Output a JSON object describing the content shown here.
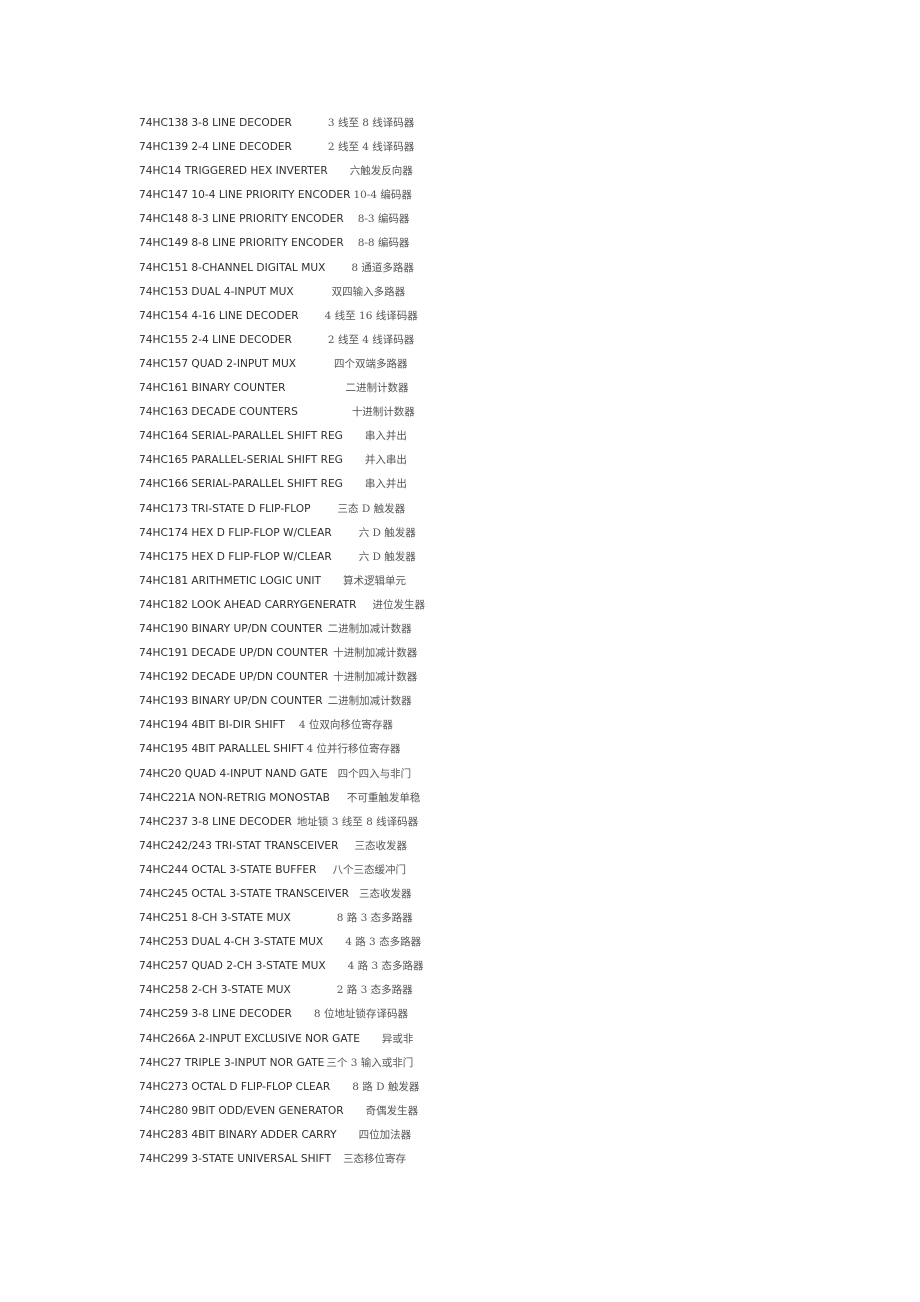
{
  "document": {
    "rows": [
      {
        "part": "74HC138 3-8 LINE DECODER",
        "gap": 36,
        "desc": "3 线至 8 线译码器"
      },
      {
        "part": "74HC139 2-4 LINE DECODER",
        "gap": 36,
        "desc": "2 线至 4 线译码器"
      },
      {
        "part": "74HC14 TRIGGERED HEX INVERTER",
        "gap": 22,
        "desc": "六触发反向器"
      },
      {
        "part": "74HC147 10-4 LINE PRIORITY ENCODER",
        "gap": 3,
        "desc": "10-4 编码器"
      },
      {
        "part": "74HC148 8-3 LINE PRIORITY ENCODER",
        "gap": 14,
        "desc": "8-3 编码器"
      },
      {
        "part": "74HC149 8-8 LINE PRIORITY ENCODER",
        "gap": 14,
        "desc": "8-8 编码器"
      },
      {
        "part": "74HC151 8-CHANNEL DIGITAL MUX",
        "gap": 26,
        "desc": "8 通道多路器"
      },
      {
        "part": "74HC153 DUAL 4-INPUT MUX",
        "gap": 38,
        "desc": "双四输入多路器"
      },
      {
        "part": "74HC154 4-16 LINE DECODER",
        "gap": 26,
        "desc": "4 线至 16 线译码器"
      },
      {
        "part": "74HC155 2-4 LINE DECODER",
        "gap": 36,
        "desc": "2 线至 4 线译码器"
      },
      {
        "part": "74HC157 QUAD 2-INPUT MUX",
        "gap": 38,
        "desc": "四个双端多路器"
      },
      {
        "part": "74HC161 BINARY COUNTER",
        "gap": 60,
        "desc": "二进制计数器"
      },
      {
        "part": "74HC163 DECADE COUNTERS",
        "gap": 54,
        "desc": "十进制计数器"
      },
      {
        "part": "74HC164 SERIAL-PARALLEL SHIFT REG",
        "gap": 22,
        "desc": "串入并出"
      },
      {
        "part": "74HC165 PARALLEL-SERIAL SHIFT REG",
        "gap": 22,
        "desc": "并入串出"
      },
      {
        "part": "74HC166 SERIAL-PARALLEL SHIFT REG",
        "gap": 22,
        "desc": "串入并出"
      },
      {
        "part": "74HC173 TRI-STATE D FLIP-FLOP",
        "gap": 27,
        "desc": "三态 D 触发器"
      },
      {
        "part": "74HC174 HEX D FLIP-FLOP W/CLEAR",
        "gap": 27,
        "desc": "六 D 触发器"
      },
      {
        "part": "74HC175 HEX D FLIP-FLOP W/CLEAR",
        "gap": 27,
        "desc": "六 D 触发器"
      },
      {
        "part": "74HC181 ARITHMETIC LOGIC UNIT",
        "gap": 22,
        "desc": "算术逻辑单元"
      },
      {
        "part": "74HC182 LOOK AHEAD CARRYGENERATR",
        "gap": 16,
        "desc": "进位发生器"
      },
      {
        "part": "74HC190 BINARY UP/DN COUNTER",
        "gap": 5,
        "desc": "二进制加减计数器"
      },
      {
        "part": "74HC191 DECADE UP/DN COUNTER",
        "gap": 5,
        "desc": "十进制加减计数器"
      },
      {
        "part": "74HC192 DECADE UP/DN COUNTER",
        "gap": 5,
        "desc": "十进制加减计数器"
      },
      {
        "part": "74HC193 BINARY UP/DN COUNTER",
        "gap": 5,
        "desc": "二进制加减计数器"
      },
      {
        "part": "74HC194 4BIT BI-DIR SHIFT",
        "gap": 14,
        "desc": "4 位双向移位寄存器"
      },
      {
        "part": "74HC195 4BIT PARALLEL SHIFT",
        "gap": 3,
        "desc": "4 位并行移位寄存器"
      },
      {
        "part": "74HC20 QUAD 4-INPUT NAND GATE",
        "gap": 10,
        "desc": "四个四入与非门"
      },
      {
        "part": "74HC221A NON-RETRIG MONOSTAB",
        "gap": 17,
        "desc": "不可重触发单稳"
      },
      {
        "part": "74HC237 3-8 LINE DECODER",
        "gap": 5,
        "desc": "地址锁 3 线至 8 线译码器"
      },
      {
        "part": "74HC242/243 TRI-STAT TRANSCEIVER",
        "gap": 16,
        "desc": "三态收发器"
      },
      {
        "part": "74HC244 OCTAL 3-STATE BUFFER",
        "gap": 16,
        "desc": "八个三态缓冲门"
      },
      {
        "part": "74HC245 OCTAL 3-STATE TRANSCEIVER",
        "gap": 10,
        "desc": "三态收发器"
      },
      {
        "part": "74HC251 8-CH 3-STATE MUX",
        "gap": 46,
        "desc": "8 路 3 态多路器"
      },
      {
        "part": "74HC253 DUAL 4-CH 3-STATE MUX",
        "gap": 22,
        "desc": "4 路 3 态多路器"
      },
      {
        "part": "74HC257 QUAD 2-CH 3-STATE MUX",
        "gap": 22,
        "desc": "4 路 3 态多路器"
      },
      {
        "part": "74HC258 2-CH 3-STATE MUX",
        "gap": 46,
        "desc": "2 路 3 态多路器"
      },
      {
        "part": "74HC259 3-8 LINE DECODER",
        "gap": 22,
        "desc": "8 位地址锁存译码器"
      },
      {
        "part": "74HC266A 2-INPUT EXCLUSIVE NOR GATE",
        "gap": 22,
        "desc": "异或非"
      },
      {
        "part": "74HC27 TRIPLE 3-INPUT NOR GATE",
        "gap": 2,
        "desc": "三个 3 输入或非门"
      },
      {
        "part": "74HC273 OCTAL D FLIP-FLOP CLEAR",
        "gap": 22,
        "desc": "8 路 D 触发器"
      },
      {
        "part": "74HC280 9BIT ODD/EVEN GENERATOR",
        "gap": 22,
        "desc": "奇偶发生器"
      },
      {
        "part": "74HC283 4BIT BINARY ADDER CARRY",
        "gap": 22,
        "desc": "四位加法器"
      },
      {
        "part": "74HC299 3-STATE UNIVERSAL SHIFT",
        "gap": 12,
        "desc": "三态移位寄存"
      }
    ]
  }
}
